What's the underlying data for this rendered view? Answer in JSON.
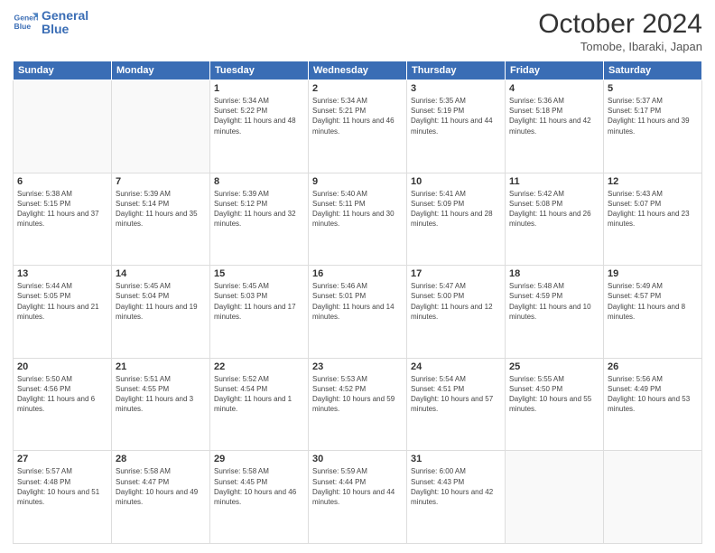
{
  "header": {
    "logo_line1": "General",
    "logo_line2": "Blue",
    "month": "October 2024",
    "location": "Tomobe, Ibaraki, Japan"
  },
  "weekdays": [
    "Sunday",
    "Monday",
    "Tuesday",
    "Wednesday",
    "Thursday",
    "Friday",
    "Saturday"
  ],
  "weeks": [
    [
      {
        "day": "",
        "info": ""
      },
      {
        "day": "",
        "info": ""
      },
      {
        "day": "1",
        "info": "Sunrise: 5:34 AM\nSunset: 5:22 PM\nDaylight: 11 hours and 48 minutes."
      },
      {
        "day": "2",
        "info": "Sunrise: 5:34 AM\nSunset: 5:21 PM\nDaylight: 11 hours and 46 minutes."
      },
      {
        "day": "3",
        "info": "Sunrise: 5:35 AM\nSunset: 5:19 PM\nDaylight: 11 hours and 44 minutes."
      },
      {
        "day": "4",
        "info": "Sunrise: 5:36 AM\nSunset: 5:18 PM\nDaylight: 11 hours and 42 minutes."
      },
      {
        "day": "5",
        "info": "Sunrise: 5:37 AM\nSunset: 5:17 PM\nDaylight: 11 hours and 39 minutes."
      }
    ],
    [
      {
        "day": "6",
        "info": "Sunrise: 5:38 AM\nSunset: 5:15 PM\nDaylight: 11 hours and 37 minutes."
      },
      {
        "day": "7",
        "info": "Sunrise: 5:39 AM\nSunset: 5:14 PM\nDaylight: 11 hours and 35 minutes."
      },
      {
        "day": "8",
        "info": "Sunrise: 5:39 AM\nSunset: 5:12 PM\nDaylight: 11 hours and 32 minutes."
      },
      {
        "day": "9",
        "info": "Sunrise: 5:40 AM\nSunset: 5:11 PM\nDaylight: 11 hours and 30 minutes."
      },
      {
        "day": "10",
        "info": "Sunrise: 5:41 AM\nSunset: 5:09 PM\nDaylight: 11 hours and 28 minutes."
      },
      {
        "day": "11",
        "info": "Sunrise: 5:42 AM\nSunset: 5:08 PM\nDaylight: 11 hours and 26 minutes."
      },
      {
        "day": "12",
        "info": "Sunrise: 5:43 AM\nSunset: 5:07 PM\nDaylight: 11 hours and 23 minutes."
      }
    ],
    [
      {
        "day": "13",
        "info": "Sunrise: 5:44 AM\nSunset: 5:05 PM\nDaylight: 11 hours and 21 minutes."
      },
      {
        "day": "14",
        "info": "Sunrise: 5:45 AM\nSunset: 5:04 PM\nDaylight: 11 hours and 19 minutes."
      },
      {
        "day": "15",
        "info": "Sunrise: 5:45 AM\nSunset: 5:03 PM\nDaylight: 11 hours and 17 minutes."
      },
      {
        "day": "16",
        "info": "Sunrise: 5:46 AM\nSunset: 5:01 PM\nDaylight: 11 hours and 14 minutes."
      },
      {
        "day": "17",
        "info": "Sunrise: 5:47 AM\nSunset: 5:00 PM\nDaylight: 11 hours and 12 minutes."
      },
      {
        "day": "18",
        "info": "Sunrise: 5:48 AM\nSunset: 4:59 PM\nDaylight: 11 hours and 10 minutes."
      },
      {
        "day": "19",
        "info": "Sunrise: 5:49 AM\nSunset: 4:57 PM\nDaylight: 11 hours and 8 minutes."
      }
    ],
    [
      {
        "day": "20",
        "info": "Sunrise: 5:50 AM\nSunset: 4:56 PM\nDaylight: 11 hours and 6 minutes."
      },
      {
        "day": "21",
        "info": "Sunrise: 5:51 AM\nSunset: 4:55 PM\nDaylight: 11 hours and 3 minutes."
      },
      {
        "day": "22",
        "info": "Sunrise: 5:52 AM\nSunset: 4:54 PM\nDaylight: 11 hours and 1 minute."
      },
      {
        "day": "23",
        "info": "Sunrise: 5:53 AM\nSunset: 4:52 PM\nDaylight: 10 hours and 59 minutes."
      },
      {
        "day": "24",
        "info": "Sunrise: 5:54 AM\nSunset: 4:51 PM\nDaylight: 10 hours and 57 minutes."
      },
      {
        "day": "25",
        "info": "Sunrise: 5:55 AM\nSunset: 4:50 PM\nDaylight: 10 hours and 55 minutes."
      },
      {
        "day": "26",
        "info": "Sunrise: 5:56 AM\nSunset: 4:49 PM\nDaylight: 10 hours and 53 minutes."
      }
    ],
    [
      {
        "day": "27",
        "info": "Sunrise: 5:57 AM\nSunset: 4:48 PM\nDaylight: 10 hours and 51 minutes."
      },
      {
        "day": "28",
        "info": "Sunrise: 5:58 AM\nSunset: 4:47 PM\nDaylight: 10 hours and 49 minutes."
      },
      {
        "day": "29",
        "info": "Sunrise: 5:58 AM\nSunset: 4:45 PM\nDaylight: 10 hours and 46 minutes."
      },
      {
        "day": "30",
        "info": "Sunrise: 5:59 AM\nSunset: 4:44 PM\nDaylight: 10 hours and 44 minutes."
      },
      {
        "day": "31",
        "info": "Sunrise: 6:00 AM\nSunset: 4:43 PM\nDaylight: 10 hours and 42 minutes."
      },
      {
        "day": "",
        "info": ""
      },
      {
        "day": "",
        "info": ""
      }
    ]
  ]
}
